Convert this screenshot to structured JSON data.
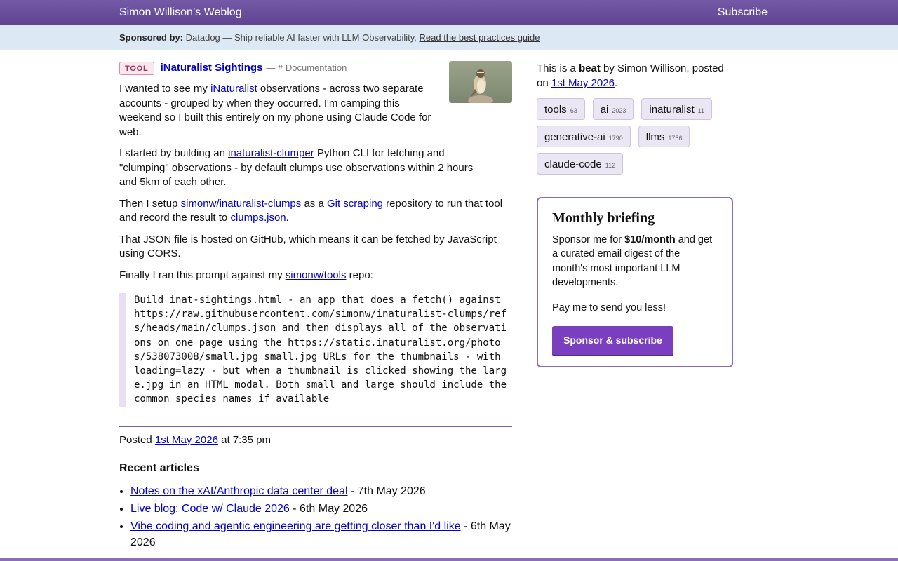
{
  "header": {
    "title": "Simon Willison’s Weblog",
    "subscribe": "Subscribe"
  },
  "sponsor": {
    "label": "Sponsored by:",
    "text": "Datadog — Ship reliable AI faster with LLM Observability.",
    "link": "Read the best practices guide"
  },
  "entry": {
    "badge": "TOOL",
    "title": "iNaturalist Sightings",
    "doc_sep": "—",
    "doc_link": "# Documentation",
    "p1": {
      "a": "I wanted to see my ",
      "l1": "iNaturalist",
      "b": " observations - across two separate accounts - grouped by when they occurred. I'm camping this weekend so I built this entirely on my phone using Claude Code for web."
    },
    "p2": {
      "a": "I started by building an ",
      "l1": "inaturalist-clumper",
      "b": " Python CLI for fetching and \"clumping\" observations - by default clumps use observations within 2 hours and 5km of each other."
    },
    "p3": {
      "a": "Then I setup ",
      "l1": "simonw/inaturalist-clumps",
      "b": " as a ",
      "l2": "Git scraping",
      "c": " repository to run that tool and record the result to ",
      "l3": "clumps.json",
      "d": "."
    },
    "p4": "That JSON file is hosted on GitHub, which means it can be fetched by JavaScript using CORS.",
    "p5": {
      "a": "Finally I ran this prompt against my ",
      "l1": "simonw/tools",
      "b": " repo:"
    },
    "prompt": "Build inat-sightings.html - an app that does a fetch() against https://raw.githubusercontent.com/simonw/inaturalist-clumps/refs/heads/main/clumps.json and then displays all of the observations on one page using the https://static.inaturalist.org/photos/538073008/small.jpg small.jpg URLs for the thumbnails - with loading=lazy - but when a thumbnail is clicked showing the large.jpg in an HTML modal. Both small and large should include the common species names if available",
    "posted_prefix": "Posted ",
    "posted_date": "1st May 2026",
    "posted_time": " at 7:35 pm"
  },
  "recent": {
    "heading": "Recent articles",
    "items": [
      {
        "title": "Notes on the xAI/Anthropic data center deal",
        "date": " - 7th May 2026"
      },
      {
        "title": "Live blog: Code w/ Claude 2026",
        "date": " - 6th May 2026"
      },
      {
        "title": "Vibe coding and agentic engineering are getting closer than I'd like",
        "date": " - 6th May 2026"
      }
    ]
  },
  "sidebar": {
    "intro_a": "This is a ",
    "intro_b": "beat",
    "intro_c": " by Simon Willison, posted on ",
    "intro_date": "1st May 2026",
    "intro_end": ".",
    "tags": [
      {
        "name": "tools",
        "count": "63"
      },
      {
        "name": "ai",
        "count": "2023"
      },
      {
        "name": "inaturalist",
        "count": "11"
      },
      {
        "name": "generative-ai",
        "count": "1790"
      },
      {
        "name": "llms",
        "count": "1756"
      },
      {
        "name": "claude-code",
        "count": "112"
      }
    ],
    "brief": {
      "title": "Monthly briefing",
      "p1_a": "Sponsor me for ",
      "p1_b": "$10/month",
      "p1_c": " and get a curated email digest of the month's most important LLM developments.",
      "p2": "Pay me to send you less!",
      "button": "Sponsor & subscribe"
    }
  },
  "colors": {
    "header": "#6a4f9a",
    "sponsor_bg": "#dde8f5",
    "accent": "#7a3fbf"
  }
}
